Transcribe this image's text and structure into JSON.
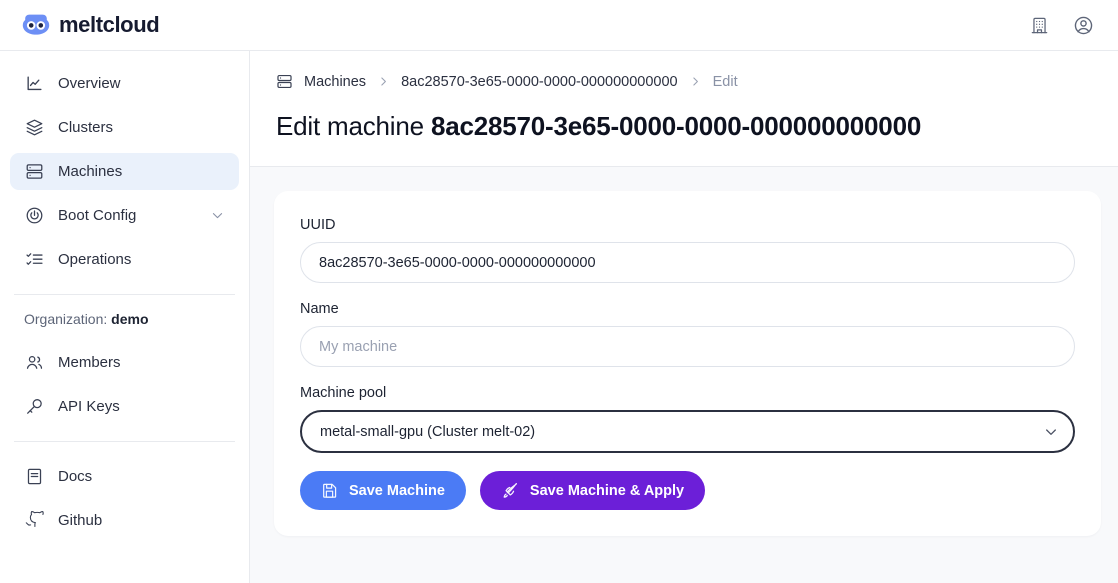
{
  "brand": {
    "name": "meltcloud",
    "logo_icon": "owl-logo-icon"
  },
  "topbar": {
    "actions": [
      {
        "name": "organization-button",
        "icon": "building-icon"
      },
      {
        "name": "account-button",
        "icon": "user-circle-icon"
      }
    ]
  },
  "sidebar": {
    "primary_items": [
      {
        "label": "Overview",
        "icon": "chart-line-icon",
        "active": false,
        "expandable": false
      },
      {
        "label": "Clusters",
        "icon": "layers-icon",
        "active": false,
        "expandable": false
      },
      {
        "label": "Machines",
        "icon": "server-icon",
        "active": true,
        "expandable": false
      },
      {
        "label": "Boot Config",
        "icon": "power-icon",
        "active": false,
        "expandable": true
      },
      {
        "label": "Operations",
        "icon": "checklist-icon",
        "active": false,
        "expandable": false
      }
    ],
    "org_prefix": "Organization:",
    "org_name": "demo",
    "org_items": [
      {
        "label": "Members",
        "icon": "users-icon"
      },
      {
        "label": "API Keys",
        "icon": "key-icon"
      }
    ],
    "footer_items": [
      {
        "label": "Docs",
        "icon": "book-icon"
      },
      {
        "label": "Github",
        "icon": "github-icon"
      }
    ]
  },
  "breadcrumb": {
    "icon": "server-icon",
    "root": "Machines",
    "separator": "›",
    "machine_id": "8ac28570-3e65-0000-0000-000000000000",
    "current": "Edit"
  },
  "page": {
    "title_prefix": "Edit machine",
    "title_id": "8ac28570-3e65-0000-0000-000000000000"
  },
  "form": {
    "uuid": {
      "label": "UUID",
      "value": "8ac28570-3e65-0000-0000-000000000000"
    },
    "name": {
      "label": "Name",
      "value": "",
      "placeholder": "My machine"
    },
    "machine_pool": {
      "label": "Machine pool",
      "selected": "metal-small-gpu (Cluster melt-02)",
      "options": [
        "metal-small-gpu (Cluster melt-02)"
      ],
      "chevron_icon": "chevron-down-icon",
      "focused": true
    },
    "buttons": {
      "save": {
        "label": "Save Machine",
        "icon": "save-disk-icon",
        "color": "#4b7bf5"
      },
      "save_apply": {
        "label": "Save Machine & Apply",
        "icon": "rocket-icon",
        "color": "#6c1fd8"
      }
    }
  },
  "colors": {
    "accent_blue": "#4b7bf5",
    "accent_purple": "#6c1fd8",
    "active_nav_bg": "#eaf1fb",
    "content_bg": "#f8f9fb",
    "border": "#e8eaee"
  }
}
